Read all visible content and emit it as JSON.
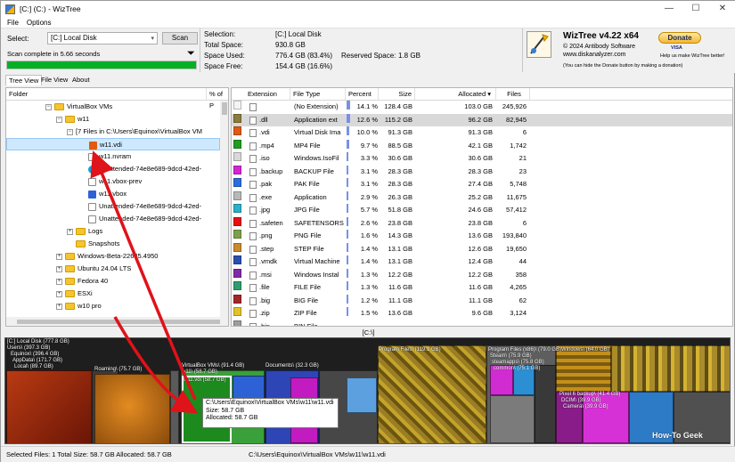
{
  "window": {
    "title": "[C:] (C:) - WizTree",
    "icon": "wiztree-app-icon",
    "controls": [
      "—",
      "☐",
      "✕"
    ]
  },
  "menu": [
    "File",
    "Options"
  ],
  "toolbar": {
    "select_label": "Select:",
    "drive_value": "[C:] Local Disk",
    "scan_label": "Scan",
    "status": "Scan complete in 5.66 seconds",
    "progress": 1.0,
    "info": {
      "selection_label": "Selection:",
      "selection_value": "[C:]  Local Disk",
      "total_label": "Total Space:",
      "total_value": "930.8 GB",
      "used_label": "Space Used:",
      "used_value": "776.4 GB  (83.4%)",
      "reserved_label": "Reserved Space:",
      "reserved_value": "1.8 GB",
      "free_label": "Space Free:",
      "free_value": "154.4 GB  (16.6%)"
    },
    "brand": {
      "name": "WizTree v4.22 x64",
      "copyright": "© 2024 Antibody Software",
      "site": "www.diskanalyzer.com",
      "note": "(You can hide the Donate button by making a donation)",
      "donate": "Donate",
      "donate_sub": "Help us make WizTree better!",
      "cards": "VISA"
    }
  },
  "tabs": [
    "Tree View",
    "File View",
    "About"
  ],
  "tree": {
    "headers": [
      "Folder",
      "% of P"
    ],
    "rows": [
      {
        "text": "VirtualBox VMs",
        "kind": "folder",
        "indent": 52,
        "exp": "−"
      },
      {
        "text": "w11",
        "kind": "folder",
        "indent": 64,
        "exp": "−"
      },
      {
        "text": "[7 Files in C:\\Users\\Equinox\\VirtualBox VM",
        "kind": "none",
        "indent": 76,
        "exp": "−"
      },
      {
        "text": "w11.vdi",
        "kind": "vdi",
        "indent": 90,
        "exp": "",
        "selected": true
      },
      {
        "text": "w11.nvram",
        "kind": "file",
        "indent": 90,
        "exp": ""
      },
      {
        "text": "Unattended-74e8e689-9dcd-42ed-",
        "kind": "edge",
        "indent": 90,
        "exp": ""
      },
      {
        "text": "w11.vbox-prev",
        "kind": "file",
        "indent": 90,
        "exp": ""
      },
      {
        "text": "w11.vbox",
        "kind": "vbox",
        "indent": 90,
        "exp": ""
      },
      {
        "text": "Unattended-74e8e689-9dcd-42ed-",
        "kind": "file",
        "indent": 90,
        "exp": ""
      },
      {
        "text": "Unattended-74e8e689-9dcd-42ed-",
        "kind": "file",
        "indent": 90,
        "exp": ""
      },
      {
        "text": "Logs",
        "kind": "folder",
        "indent": 76,
        "exp": "+"
      },
      {
        "text": "Snapshots",
        "kind": "folder",
        "indent": 76,
        "exp": ""
      },
      {
        "text": "Windows-Beta-22635.4950",
        "kind": "folder",
        "indent": 64,
        "exp": "+"
      },
      {
        "text": "Ubuntu 24.04 LTS",
        "kind": "folder",
        "indent": 64,
        "exp": "+"
      },
      {
        "text": "Fedora 40",
        "kind": "folder",
        "indent": 64,
        "exp": "+"
      },
      {
        "text": "ESXi",
        "kind": "folder",
        "indent": 64,
        "exp": "+"
      },
      {
        "text": "w10 pro",
        "kind": "folder",
        "indent": 64,
        "exp": "+"
      }
    ]
  },
  "ext": {
    "headers": [
      "Extension",
      "File Type",
      "Percent",
      "Size",
      "Allocated ▾",
      "Files"
    ],
    "rows": [
      {
        "color": "#f4f4f4",
        "icon": "blank-icon",
        "ext": "",
        "type": "(No Extension)",
        "pct": "14.1 %",
        "p": 14.1,
        "size": "128.4 GB",
        "alloc": "103.0 GB",
        "files": "245,926"
      },
      {
        "color": "#8b7d3a",
        "icon": "dll-icon",
        "ext": ".dll",
        "type": "Application ext",
        "pct": "12.6 %",
        "p": 12.6,
        "size": "115.2 GB",
        "alloc": "96.2 GB",
        "files": "82,945",
        "selected": true
      },
      {
        "color": "#e05a10",
        "icon": "vdi-icon",
        "ext": ".vdi",
        "type": "Virtual Disk Ima",
        "pct": "10.0 %",
        "p": 10.0,
        "size": "91.3 GB",
        "alloc": "91.3 GB",
        "files": "6"
      },
      {
        "color": "#1f9e1f",
        "icon": "mp4-icon",
        "ext": ".mp4",
        "type": "MP4 File",
        "pct": "9.7 %",
        "p": 9.7,
        "size": "88.5 GB",
        "alloc": "42.1 GB",
        "files": "1,742"
      },
      {
        "color": "#d9d9d9",
        "icon": "file-icon",
        "ext": ".iso",
        "type": "Windows.IsoFil",
        "pct": "3.3 %",
        "p": 3.3,
        "size": "30.6 GB",
        "alloc": "30.6 GB",
        "files": "21"
      },
      {
        "color": "#d424d4",
        "icon": "file-icon",
        "ext": ".backup",
        "type": "BACKUP File",
        "pct": "3.1 %",
        "p": 3.1,
        "size": "28.3 GB",
        "alloc": "28.3 GB",
        "files": "23"
      },
      {
        "color": "#2d6be0",
        "icon": "file-icon",
        "ext": ".pak",
        "type": "PAK File",
        "pct": "3.1 %",
        "p": 3.1,
        "size": "28.3 GB",
        "alloc": "27.4 GB",
        "files": "5,748"
      },
      {
        "color": "#b8b8b8",
        "icon": "exe-icon",
        "ext": ".exe",
        "type": "Application",
        "pct": "2.9 %",
        "p": 2.9,
        "size": "26.3 GB",
        "alloc": "25.2 GB",
        "files": "11,675"
      },
      {
        "color": "#2ab0c9",
        "icon": "jpg-icon",
        "ext": ".jpg",
        "type": "JPG File",
        "pct": "5.7 %",
        "p": 5.7,
        "size": "51.8 GB",
        "alloc": "24.6 GB",
        "files": "57,412"
      },
      {
        "color": "#e81010",
        "icon": "file-icon",
        "ext": ".safeten",
        "type": "SAFETENSORS",
        "pct": "2.6 %",
        "p": 2.6,
        "size": "23.8 GB",
        "alloc": "23.8 GB",
        "files": "6"
      },
      {
        "color": "#7fa04a",
        "icon": "png-icon",
        "ext": ".png",
        "type": "PNG File",
        "pct": "1.6 %",
        "p": 1.6,
        "size": "14.3 GB",
        "alloc": "13.6 GB",
        "files": "193,840"
      },
      {
        "color": "#c98a2e",
        "icon": "file-icon",
        "ext": ".step",
        "type": "STEP File",
        "pct": "1.4 %",
        "p": 1.4,
        "size": "13.1 GB",
        "alloc": "12.6 GB",
        "files": "19,650"
      },
      {
        "color": "#2a4fb0",
        "icon": "vmdk-icon",
        "ext": ".vmdk",
        "type": "Virtual Machine",
        "pct": "1.4 %",
        "p": 1.4,
        "size": "13.1 GB",
        "alloc": "12.4 GB",
        "files": "44"
      },
      {
        "color": "#7f2aa8",
        "icon": "msi-icon",
        "ext": ".msi",
        "type": "Windows Instal",
        "pct": "1.3 %",
        "p": 1.3,
        "size": "12.2 GB",
        "alloc": "12.2 GB",
        "files": "358"
      },
      {
        "color": "#2d9e6f",
        "icon": "file-icon",
        "ext": ".file",
        "type": "FILE File",
        "pct": "1.3 %",
        "p": 1.3,
        "size": "11.6 GB",
        "alloc": "11.6 GB",
        "files": "4,265"
      },
      {
        "color": "#a3262a",
        "icon": "file-icon",
        "ext": ".big",
        "type": "BIG File",
        "pct": "1.2 %",
        "p": 1.2,
        "size": "11.1 GB",
        "alloc": "11.1 GB",
        "files": "62"
      },
      {
        "color": "#e3c226",
        "icon": "zip-icon",
        "ext": ".zip",
        "type": "ZIP File",
        "pct": "1.5 %",
        "p": 1.5,
        "size": "13.6 GB",
        "alloc": "9.6 GB",
        "files": "3,124"
      },
      {
        "color": "#9d9d9d",
        "icon": "file-icon",
        "ext": ".bin",
        "type": "BIN File",
        "pct": "",
        "p": 0,
        "size": "",
        "alloc": "",
        "files": ""
      }
    ]
  },
  "treemap": {
    "path": "[C:\\]",
    "labels": {
      "root": "[C:] Local Disk  (777.8 GB)",
      "users": "Users\\  (397.3 GB)",
      "equinox": "Equinox\\  (396.4 GB)",
      "appdata": "AppData\\  (171.7 GB)",
      "local": "Local\\  (89.7 GB)",
      "roaming": "Roaming\\  (75.7 GB)",
      "vbox": "VirtualBox VMs\\  (91.4 GB)",
      "w11": "w11\\  (58.7 GB)",
      "w11vdi": "w11.vdi  (58.7 GB)",
      "documents": "Documents\\  (32.3 GB)",
      "pf": "Program Files\\  (119.1 GB)",
      "pfx86": "Program Files (x86)\\  (79.0 GB)",
      "steam": "Steam\\  (75.9 GB)",
      "steamapps": "steamapps\\  (75.8 GB)",
      "common": "common\\  (75.1 GB)",
      "windows": "Windows\\  (64.0 GB)",
      "pagefile": "Pixel 6 backup\\  (41.4 GB)",
      "dcim": "DCIM\\  (39.9 GB)",
      "camera": "Camera\\  (39.9 GB)"
    },
    "tooltip": [
      "C:\\Users\\Equinox\\VirtualBox VMs\\w11\\w11.vdi",
      "Size: 58.7 GB",
      "Allocated: 58.7 GB"
    ],
    "watermark": "How-To Geek"
  },
  "status": {
    "selected": "Selected Files: 1  Total Size: 58.7 GB  Allocated: 58.7 GB",
    "path": "C:\\Users\\Equinox\\VirtualBox VMs\\w11\\w11.vdi"
  },
  "accent": {
    "selection": "#cde8ff",
    "progress": "#06b025",
    "arrow": "#e0121a"
  }
}
